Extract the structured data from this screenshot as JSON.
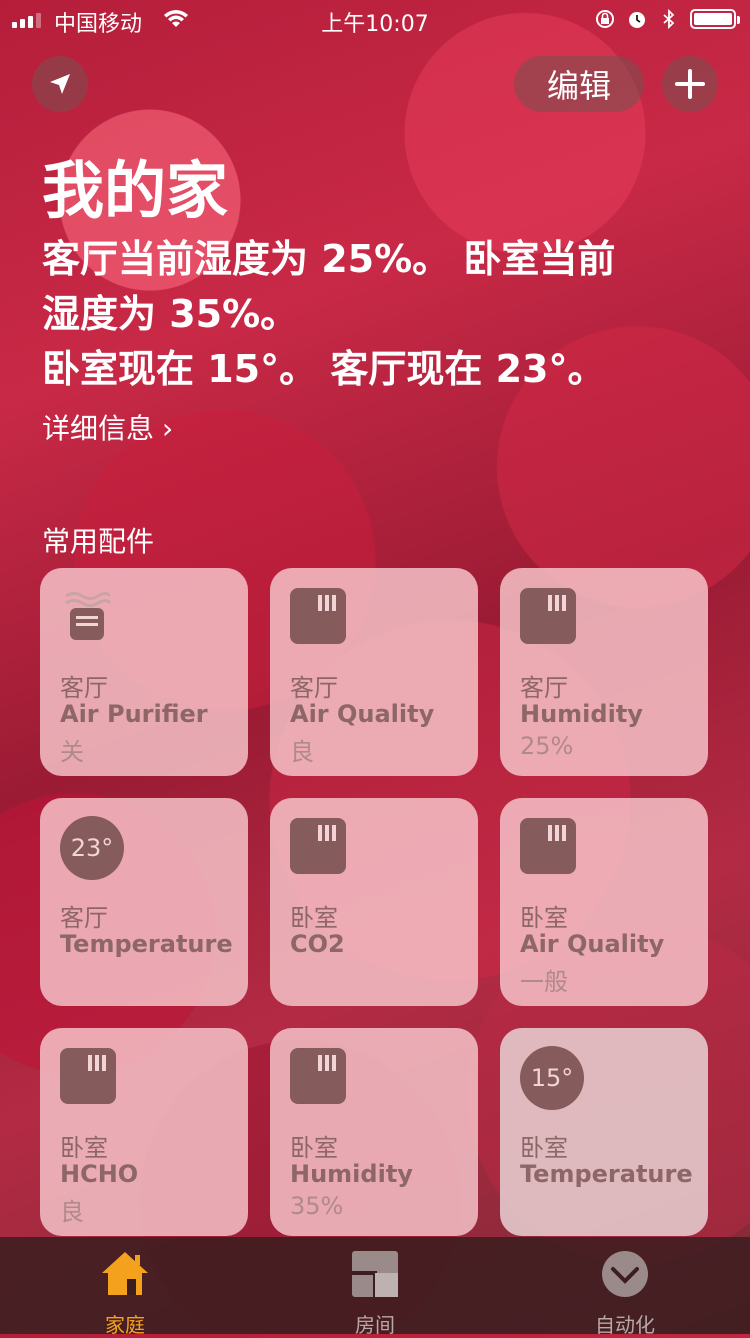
{
  "status_bar": {
    "carrier": "中国移动",
    "time": "上午10:07"
  },
  "header": {
    "edit_label": "编辑"
  },
  "home": {
    "title": "我的家",
    "summary_line1": "客厅当前湿度为 25%。 卧室当前",
    "summary_line2": "湿度为 35%。",
    "summary_line3": "卧室现在 15°。 客厅现在 23°。",
    "details_label": "详细信息"
  },
  "favorites": {
    "title": "常用配件",
    "tiles": [
      {
        "room": "客厅",
        "name": "Air Purifier",
        "state": "关",
        "icon": "air-purifier-icon"
      },
      {
        "room": "客厅",
        "name": "Air Quality",
        "state": "良",
        "icon": "sensor-icon"
      },
      {
        "room": "客厅",
        "name": "Humidity",
        "state": "25%",
        "icon": "sensor-icon"
      },
      {
        "room": "客厅",
        "name": "Temperature",
        "state": "",
        "icon": "temperature-badge",
        "badge": "23°"
      },
      {
        "room": "卧室",
        "name": "CO2",
        "state": "",
        "icon": "sensor-icon"
      },
      {
        "room": "卧室",
        "name": "Air Quality",
        "state": "一般",
        "icon": "sensor-icon"
      },
      {
        "room": "卧室",
        "name": "HCHO",
        "state": "良",
        "icon": "sensor-icon"
      },
      {
        "room": "卧室",
        "name": "Humidity",
        "state": "35%",
        "icon": "sensor-icon"
      },
      {
        "room": "卧室",
        "name": "Temperature",
        "state": "",
        "icon": "temperature-badge",
        "badge": "15°"
      }
    ]
  },
  "tabbar": {
    "tabs": [
      {
        "label": "家庭",
        "icon": "house-icon",
        "active": true
      },
      {
        "label": "房间",
        "icon": "rooms-icon",
        "active": false
      },
      {
        "label": "自动化",
        "icon": "clock-check-icon",
        "active": false
      }
    ],
    "active_color": "#f4a21d"
  }
}
